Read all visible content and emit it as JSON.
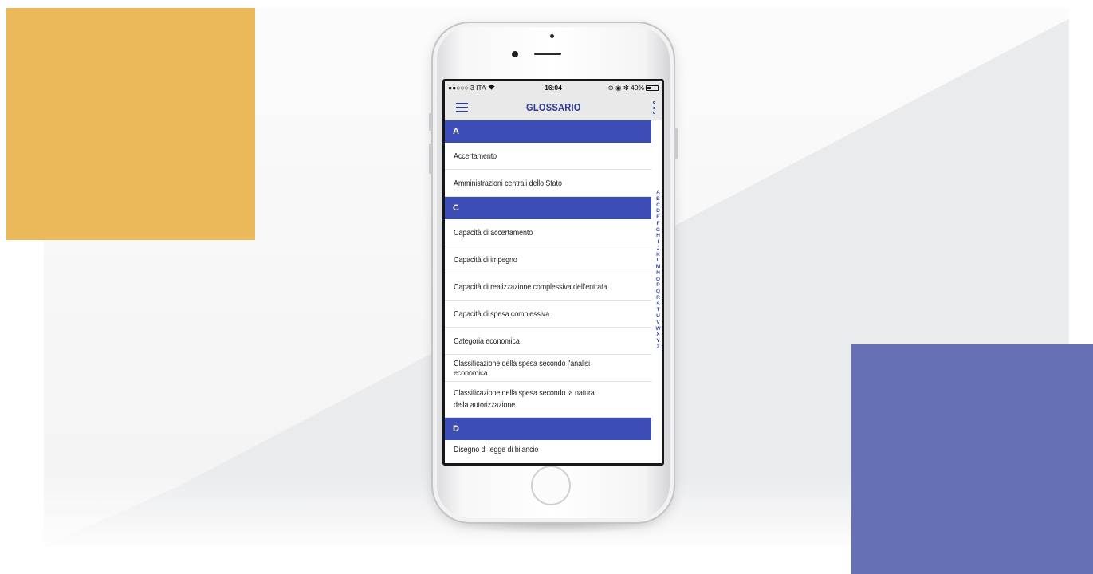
{
  "colors": {
    "accent": "#3c4db8",
    "title": "#2d3a9e",
    "deco_yellow": "#ebb95a",
    "deco_blue": "#6670b4"
  },
  "status_bar": {
    "carrier": "●●○○○ 3 ITA",
    "wifi_icon": "wifi-icon",
    "time": "16:04",
    "indicators": "⊕ ◉ ✻",
    "battery_percent": "40%"
  },
  "app_bar": {
    "menu_icon": "hamburger-menu-icon",
    "title": "GLOSSARIO",
    "more_icon": "vertical-dots-icon"
  },
  "glossary": {
    "sections": [
      {
        "letter": "A",
        "items": [
          "Accertamento",
          "Amministrazioni centrali dello Stato"
        ]
      },
      {
        "letter": "C",
        "items": [
          "Capacità di accertamento",
          "Capacità di impegno",
          "Capacità di realizzazione complessiva dell'entrata",
          "Capacità di spesa complessiva",
          "Categoria economica",
          "Classificazione della spesa secondo l'analisi economica",
          "Classificazione della spesa secondo la natura della autorizzazione"
        ]
      },
      {
        "letter": "D",
        "items": [
          "Disegno di legge di bilancio"
        ]
      }
    ]
  },
  "az_index": [
    "A",
    "B",
    "C",
    "D",
    "E",
    "F",
    "G",
    "H",
    "I",
    "J",
    "K",
    "L",
    "M",
    "N",
    "O",
    "P",
    "Q",
    "R",
    "S",
    "T",
    "U",
    "V",
    "W",
    "X",
    "Y",
    "Z"
  ]
}
